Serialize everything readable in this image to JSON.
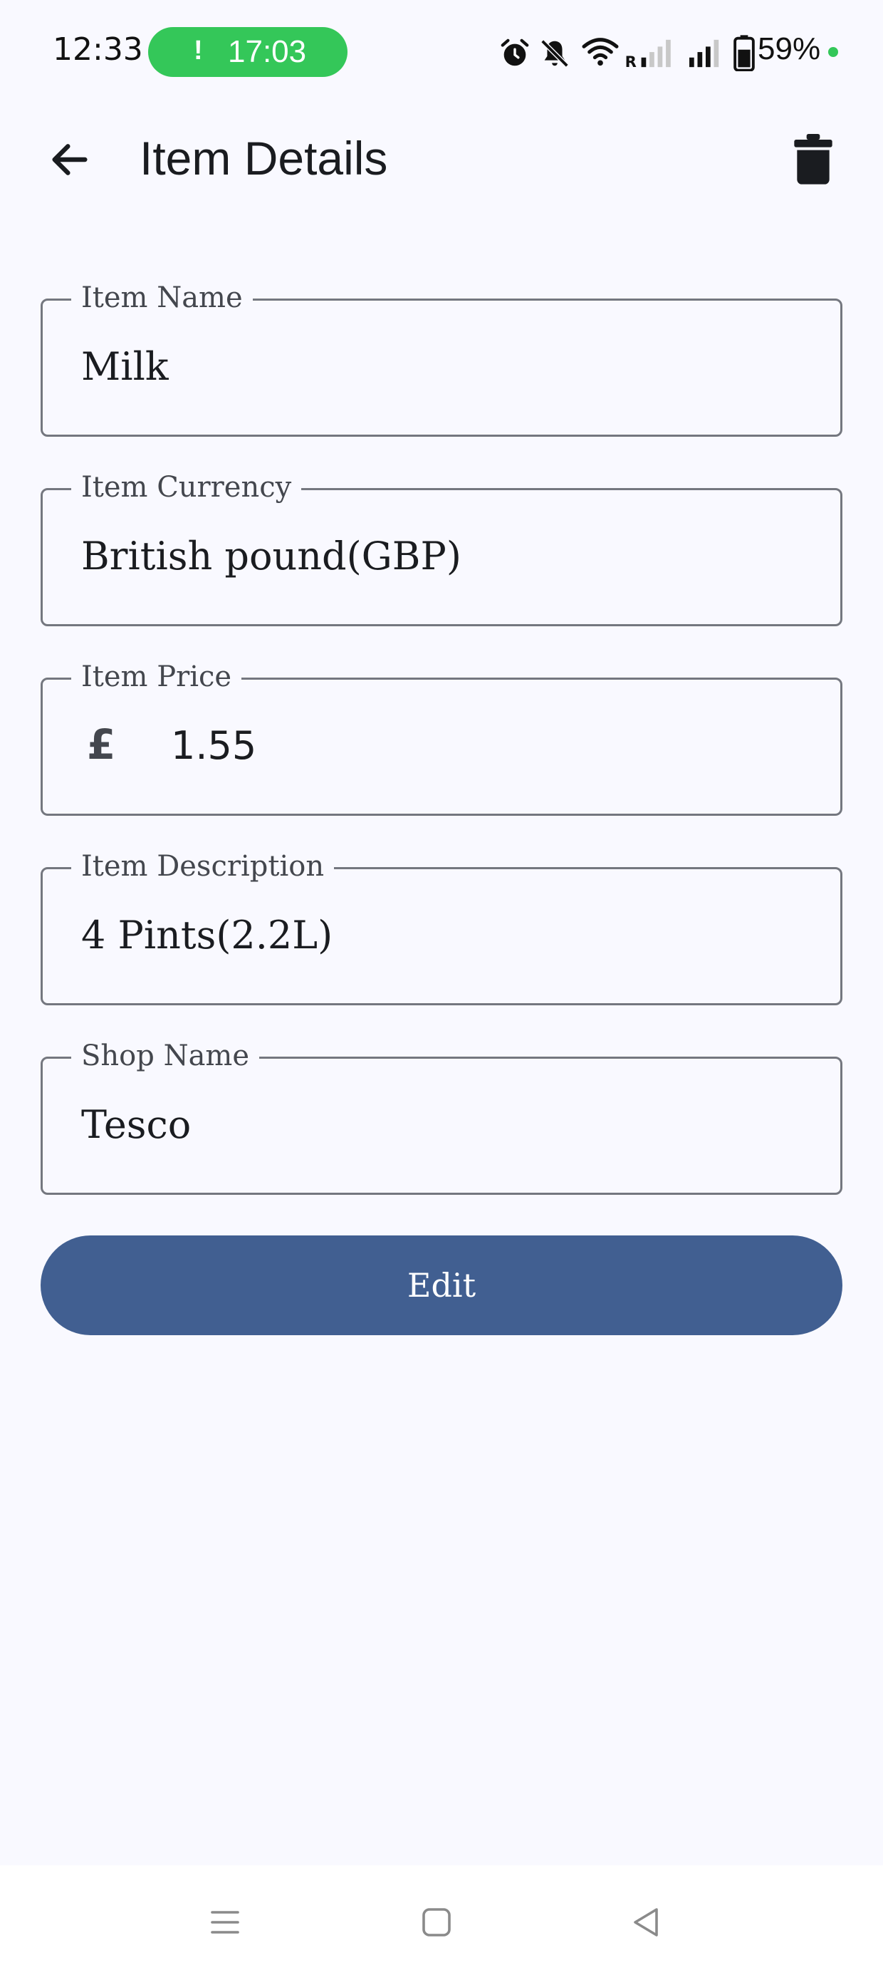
{
  "status_bar": {
    "time": "12:33",
    "call_timer": "17:03",
    "battery": "59%",
    "icons": [
      "alarm-icon",
      "notifications-off-icon",
      "wifi-icon",
      "signal-r-icon",
      "signal-icon",
      "battery-icon"
    ],
    "accent_color": "#34C759"
  },
  "app_bar": {
    "title": "Item Details",
    "back_icon": "arrow-back-icon",
    "delete_icon": "trash-icon"
  },
  "form": {
    "item_name": {
      "label": "Item Name",
      "value": "Milk"
    },
    "item_currency": {
      "label": "Item Currency",
      "value": "British pound(GBP)"
    },
    "item_price": {
      "label": "Item Price",
      "prefix": "£",
      "value": "1.55"
    },
    "item_description": {
      "label": "Item Description",
      "value": "4 Pints(2.2L)"
    },
    "shop_name": {
      "label": "Shop Name",
      "value": "Tesco"
    }
  },
  "edit_button": {
    "label": "Edit",
    "color": "#415F91"
  },
  "nav_bar": {
    "icons": [
      "menu-nav-icon",
      "home-nav-icon",
      "back-nav-icon"
    ]
  }
}
